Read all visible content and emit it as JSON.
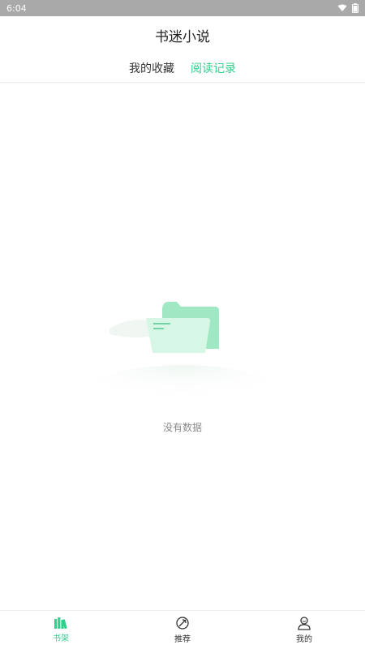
{
  "status_bar": {
    "time": "6:04",
    "icons": [
      "wifi-icon",
      "battery-icon"
    ],
    "background": "#a9a9a9"
  },
  "app": {
    "title": "书迷小说"
  },
  "tabs": [
    {
      "label": "我的收藏",
      "active": false
    },
    {
      "label": "阅读记录",
      "active": true
    }
  ],
  "empty_state": {
    "icon": "empty-folder-icon",
    "message": "没有数据"
  },
  "bottom_nav": [
    {
      "label": "书架",
      "icon": "bookshelf-icon",
      "active": true
    },
    {
      "label": "推荐",
      "icon": "recommend-icon",
      "active": false
    },
    {
      "label": "我的",
      "icon": "profile-icon",
      "active": false
    }
  ],
  "colors": {
    "accent": "#2fcf8c",
    "text_primary": "#222222",
    "text_muted": "#8a8a8a"
  }
}
